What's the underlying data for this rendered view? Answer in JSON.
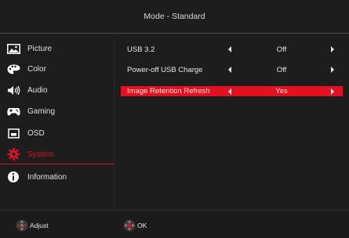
{
  "header": {
    "title": "Mode - Standard"
  },
  "sidebar": {
    "items": [
      {
        "label": "Picture",
        "icon": "picture-icon"
      },
      {
        "label": "Color",
        "icon": "palette-icon"
      },
      {
        "label": "Audio",
        "icon": "speaker-icon"
      },
      {
        "label": "Gaming",
        "icon": "gamepad-icon"
      },
      {
        "label": "OSD",
        "icon": "osd-window-icon"
      },
      {
        "label": "System",
        "icon": "gear-icon",
        "active": true
      },
      {
        "label": "Information",
        "icon": "info-icon"
      }
    ]
  },
  "settings": {
    "rows": [
      {
        "label": "USB 3.2",
        "value": "Off"
      },
      {
        "label": "Power-off USB Charge",
        "value": "Off"
      },
      {
        "label": "Image Retention Refresh",
        "value": "Yes",
        "selected": true
      }
    ]
  },
  "footer": {
    "adjust_label": "Adjust",
    "ok_label": "OK"
  },
  "colors": {
    "accent": "#e3101f",
    "background": "#1d1d1d",
    "text": "#e6e6e6"
  }
}
